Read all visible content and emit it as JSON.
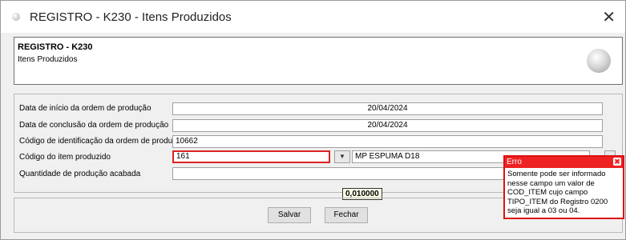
{
  "window": {
    "title": "REGISTRO - K230 - Itens Produzidos",
    "close_glyph": "✕"
  },
  "header": {
    "title": "REGISTRO - K230",
    "subtitle": "Itens Produzidos"
  },
  "form": {
    "data_inicio": {
      "label": "Data de início da ordem de produção",
      "value": "20/04/2024"
    },
    "data_conclusao": {
      "label": "Data de conclusão da ordem de produção",
      "value": "20/04/2024"
    },
    "codigo_ordem": {
      "label": "Código de identificação da ordem de produção",
      "value": "10662"
    },
    "codigo_item": {
      "label": "Código do item produzido",
      "value": "161",
      "description": "MP ESPUMA D18"
    },
    "quantidade": {
      "label": "Quantidade de produção acabada",
      "value": ""
    }
  },
  "tooltip": "0,010000",
  "buttons": {
    "save": "Salvar",
    "close": "Fechar"
  },
  "error": {
    "title": "Erro",
    "message": "Somente pode ser informado nesse campo um valor de COD_ITEM cujo campo TIPO_ITEM do Registro 0200 seja igual a 03 ou 04."
  },
  "colors": {
    "error_red": "#e22222",
    "window_bg": "#f0f0f0"
  }
}
